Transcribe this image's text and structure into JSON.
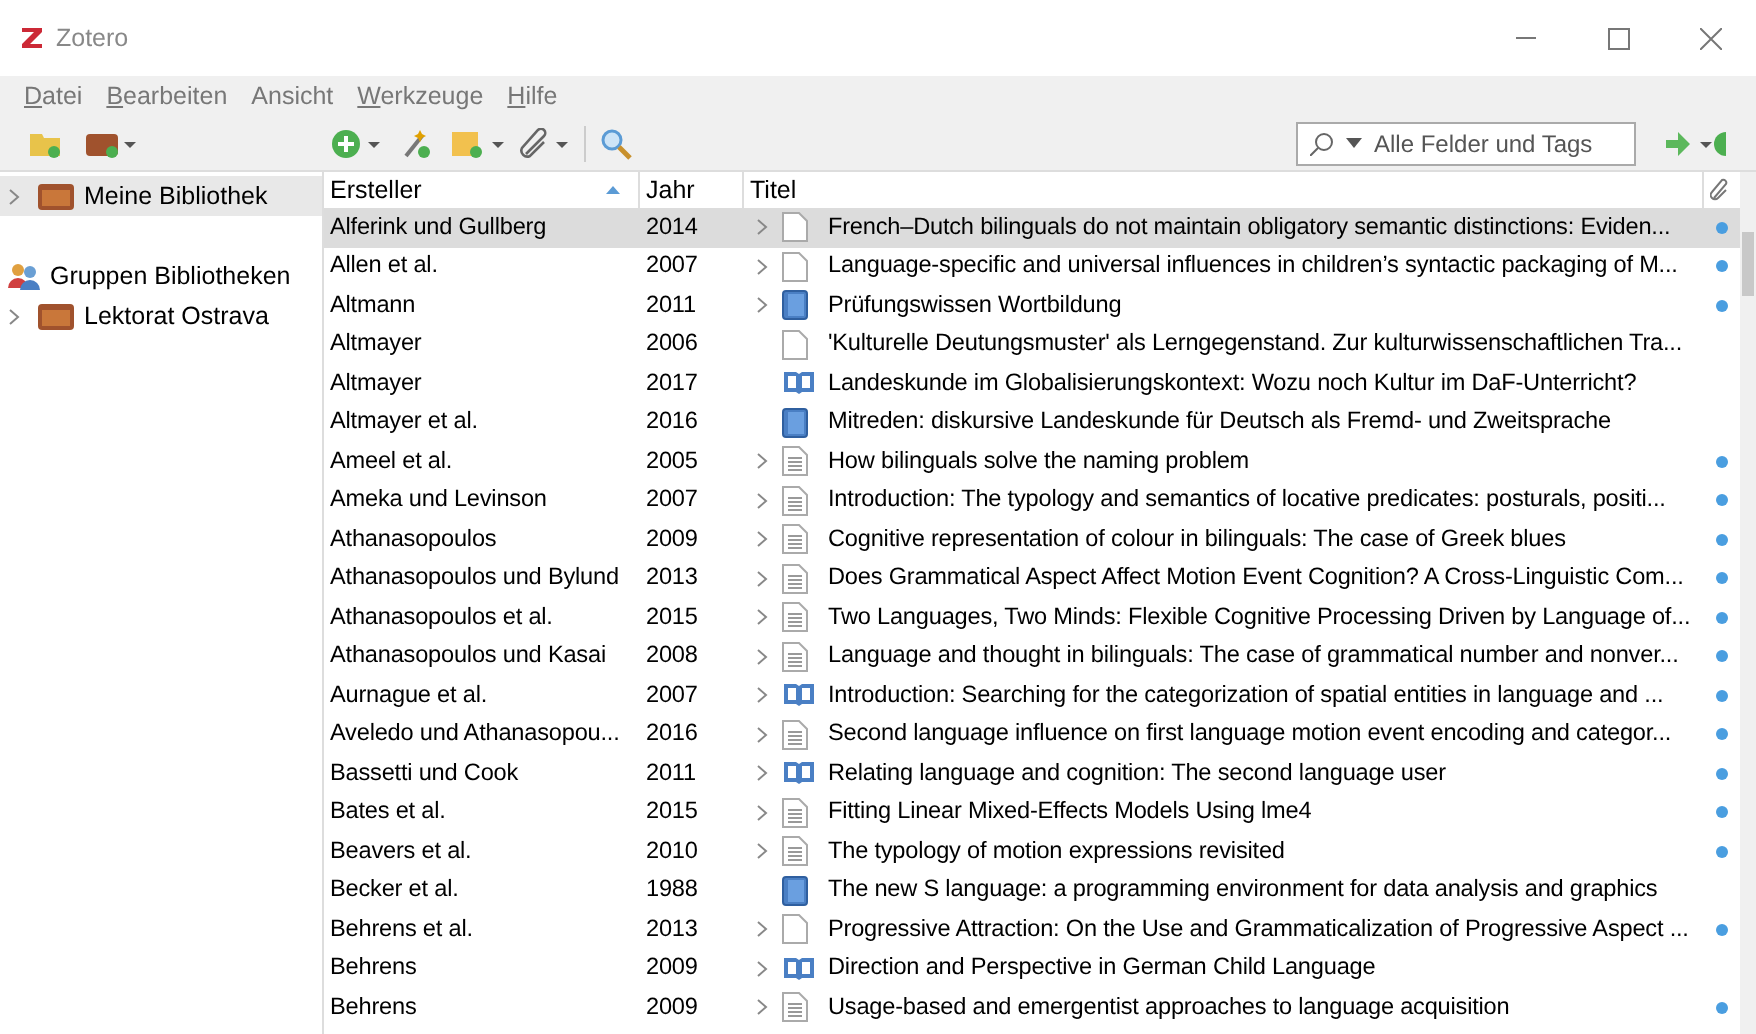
{
  "window": {
    "title": "Zotero"
  },
  "menu": [
    {
      "label": "Datei",
      "access_key": true
    },
    {
      "label": "Bearbeiten",
      "access_key": true
    },
    {
      "label": "Ansicht",
      "access_key": false
    },
    {
      "label": "Werkzeuge",
      "access_key": true
    },
    {
      "label": "Hilfe",
      "access_key": true
    }
  ],
  "search": {
    "placeholder": "Alle Felder und Tags"
  },
  "sidebar": {
    "items": [
      {
        "kind": "library",
        "label": "Meine Bibliothek",
        "expanded": false,
        "selected": true
      },
      {
        "kind": "header",
        "label": "Gruppen Bibliotheken"
      },
      {
        "kind": "library",
        "label": "Lektorat Ostrava",
        "expanded": false,
        "selected": false
      }
    ]
  },
  "table": {
    "columns": [
      {
        "label": "Ersteller",
        "sorted": true
      },
      {
        "label": "Jahr",
        "sorted": false
      },
      {
        "label": "Titel",
        "sorted": false
      }
    ],
    "rows": [
      {
        "creator": "Alferink und Gullberg",
        "year": "2014",
        "expandable": true,
        "kind": "document",
        "title": "French–Dutch bilinguals do not maintain obligatory semantic distinctions: Eviden...",
        "attachment": true,
        "selected": true
      },
      {
        "creator": "Allen et al.",
        "year": "2007",
        "expandable": true,
        "kind": "document",
        "title": "Language-specific and universal influences in children’s syntactic packaging of M...",
        "attachment": true,
        "selected": false
      },
      {
        "creator": "Altmann",
        "year": "2011",
        "expandable": true,
        "kind": "book",
        "title": "Prüfungswissen Wortbildung",
        "attachment": true,
        "selected": false
      },
      {
        "creator": "Altmayer",
        "year": "2006",
        "expandable": false,
        "kind": "document",
        "title": "'Kulturelle Deutungsmuster' als Lerngegenstand. Zur kulturwissenschaftlichen Tra...",
        "attachment": false,
        "selected": false
      },
      {
        "creator": "Altmayer",
        "year": "2017",
        "expandable": false,
        "kind": "section",
        "title": "Landeskunde im Globalisierungskontext: Wozu noch Kultur im DaF-Unterricht?",
        "attachment": false,
        "selected": false
      },
      {
        "creator": "Altmayer et al.",
        "year": "2016",
        "expandable": false,
        "kind": "book",
        "title": "Mitreden: diskursive Landeskunde für Deutsch als Fremd- und Zweitsprache",
        "attachment": false,
        "selected": false
      },
      {
        "creator": "Ameel et al.",
        "year": "2005",
        "expandable": true,
        "kind": "article",
        "title": "How bilinguals solve the naming problem",
        "attachment": true,
        "selected": false
      },
      {
        "creator": "Ameka und Levinson",
        "year": "2007",
        "expandable": true,
        "kind": "article",
        "title": "Introduction: The typology and semantics of locative predicates: posturals, positi...",
        "attachment": true,
        "selected": false
      },
      {
        "creator": "Athanasopoulos",
        "year": "2009",
        "expandable": true,
        "kind": "article",
        "title": "Cognitive representation of colour in bilinguals: The case of Greek blues",
        "attachment": true,
        "selected": false
      },
      {
        "creator": "Athanasopoulos und Bylund",
        "year": "2013",
        "expandable": true,
        "kind": "article",
        "title": "Does Grammatical Aspect Affect Motion Event Cognition? A Cross-Linguistic Com...",
        "attachment": true,
        "selected": false
      },
      {
        "creator": "Athanasopoulos et al.",
        "year": "2015",
        "expandable": true,
        "kind": "article",
        "title": "Two Languages, Two Minds: Flexible Cognitive Processing Driven by Language of...",
        "attachment": true,
        "selected": false
      },
      {
        "creator": "Athanasopoulos und Kasai",
        "year": "2008",
        "expandable": true,
        "kind": "article",
        "title": "Language and thought in bilinguals: The case of grammatical number and nonver...",
        "attachment": true,
        "selected": false
      },
      {
        "creator": "Aurnague et al.",
        "year": "2007",
        "expandable": true,
        "kind": "section",
        "title": "Introduction: Searching for the categorization of spatial entities in language and ...",
        "attachment": true,
        "selected": false
      },
      {
        "creator": "Aveledo und Athanasopou...",
        "year": "2016",
        "expandable": true,
        "kind": "article",
        "title": "Second language influence on first language motion event encoding and categor...",
        "attachment": true,
        "selected": false
      },
      {
        "creator": "Bassetti und Cook",
        "year": "2011",
        "expandable": true,
        "kind": "section",
        "title": "Relating language and cognition: The second language user",
        "attachment": true,
        "selected": false
      },
      {
        "creator": "Bates et al.",
        "year": "2015",
        "expandable": true,
        "kind": "article",
        "title": "Fitting Linear Mixed-Effects Models Using lme4",
        "attachment": true,
        "selected": false
      },
      {
        "creator": "Beavers et al.",
        "year": "2010",
        "expandable": true,
        "kind": "article",
        "title": "The typology of motion expressions revisited",
        "attachment": true,
        "selected": false
      },
      {
        "creator": "Becker et al.",
        "year": "1988",
        "expandable": false,
        "kind": "book",
        "title": "The new S language: a programming environment for data analysis and graphics",
        "attachment": false,
        "selected": false
      },
      {
        "creator": "Behrens et al.",
        "year": "2013",
        "expandable": true,
        "kind": "document",
        "title": "Progressive Attraction: On the Use and Grammaticalization of Progressive Aspect ...",
        "attachment": true,
        "selected": false
      },
      {
        "creator": "Behrens",
        "year": "2009",
        "expandable": true,
        "kind": "section",
        "title": "Direction and Perspective in German Child Language",
        "attachment": false,
        "selected": false
      },
      {
        "creator": "Behrens",
        "year": "2009",
        "expandable": true,
        "kind": "article",
        "title": "Usage-based and emergentist approaches to language acquisition",
        "attachment": true,
        "selected": false
      }
    ]
  }
}
